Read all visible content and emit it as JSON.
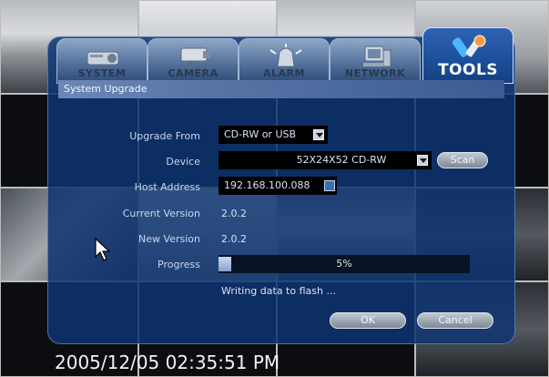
{
  "tabs": [
    {
      "label": "SYSTEM",
      "icon": "projector-icon"
    },
    {
      "label": "CAMERA",
      "icon": "cctv-camera-icon"
    },
    {
      "label": "ALARM",
      "icon": "alarm-siren-icon"
    },
    {
      "label": "NETWORK",
      "icon": "network-computer-icon"
    },
    {
      "label": "TOOLS",
      "icon": "tools-icon"
    }
  ],
  "active_tab": "TOOLS",
  "dialog": {
    "title": "System Upgrade",
    "upgrade_from_label": "Upgrade From",
    "upgrade_from_value": "CD-RW or USB",
    "device_label": "Device",
    "device_value": "52X24X52 CD-RW",
    "scan_label": "Scan",
    "host_address_label": "Host Address",
    "host_address_value": "192.168.100.088",
    "current_version_label": "Current Version",
    "current_version_value": "2.0.2",
    "new_version_label": "New Version",
    "new_version_value": "2.0.2",
    "progress_label": "Progress",
    "progress_percent": 5,
    "progress_text": "5%",
    "status_text": "Writing data to flash ...",
    "ok_label": "OK",
    "cancel_label": "Cancel"
  },
  "timestamp": "2005/12/05 02:35:51 PM",
  "colors": {
    "dialog_bg": "#0e3470",
    "active_tab": "#1b4f99",
    "progress_fill": "#8aa3cc"
  }
}
